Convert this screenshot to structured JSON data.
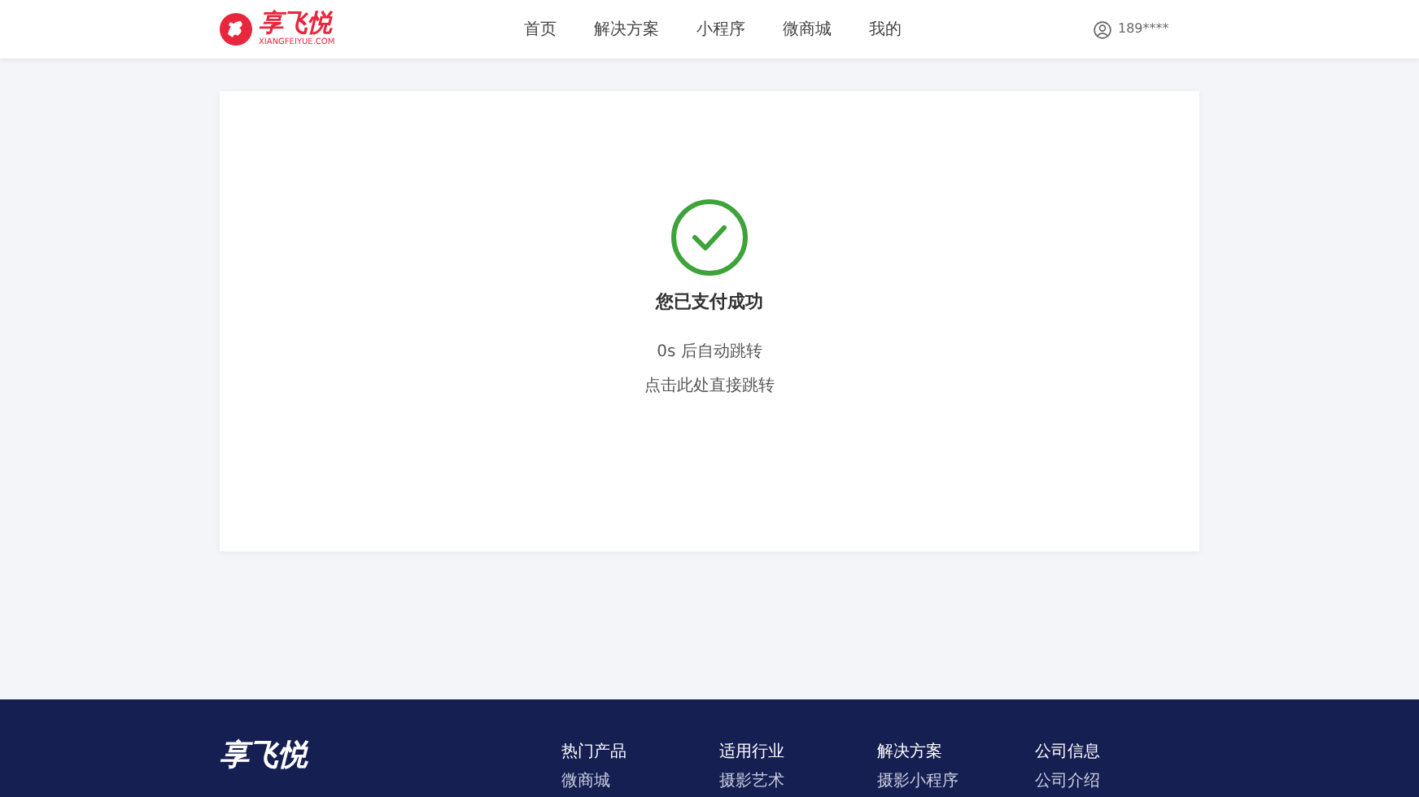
{
  "header": {
    "logo": {
      "name": "享飞悦",
      "domain": "XIANGFEIYUE.COM"
    },
    "nav": [
      {
        "label": "首页",
        "selected": false
      },
      {
        "label": "解决方案",
        "selected": false
      },
      {
        "label": "小程序",
        "selected": false
      },
      {
        "label": "微商城",
        "selected": false
      },
      {
        "label": "我的",
        "selected": false
      }
    ],
    "user": {
      "phone": "189****"
    }
  },
  "result": {
    "title": "您已支付成功",
    "countdown": "0s 后自动跳转",
    "link": "点击此处直接跳转"
  },
  "footer": {
    "logo": "享飞悦",
    "columns": [
      {
        "heading": "热门产品",
        "links": [
          "微商城"
        ]
      },
      {
        "heading": "适用行业",
        "links": [
          "摄影艺术"
        ]
      },
      {
        "heading": "解决方案",
        "links": [
          "摄影小程序"
        ]
      },
      {
        "heading": "公司信息",
        "links": [
          "公司介绍"
        ]
      }
    ]
  }
}
